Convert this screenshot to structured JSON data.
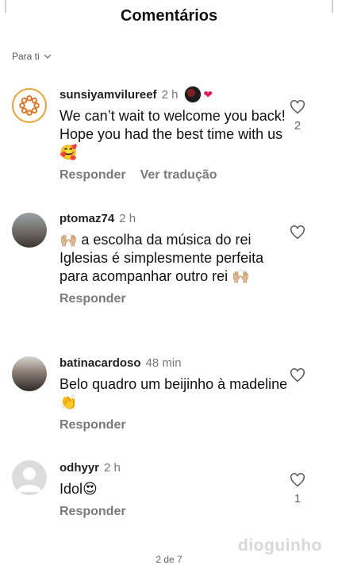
{
  "header": {
    "title": "Comentários"
  },
  "filter": {
    "label": "Para ti"
  },
  "comments": [
    {
      "user": "sunsiyamvilureef",
      "time": "2 h",
      "text": "We can’t wait to welcome you back! Hope you had the best time with us 🥰",
      "reply": "Responder",
      "translate": "Ver tradução",
      "likes": "2"
    },
    {
      "user": "ptomaz74",
      "time": "2 h",
      "text": "🙌🏼 a escolha da música do rei Iglesias é simplesmente perfeita para acompanhar outro rei 🙌🏼",
      "reply": "Responder",
      "likes": ""
    },
    {
      "user": "batinacardoso",
      "time": "48 min",
      "text": "Belo quadro um beijinho à madeline 👏",
      "reply": "Responder",
      "likes": ""
    },
    {
      "user": "odhyyr",
      "time": "2 h",
      "text": "Idol😍",
      "reply": "Responder",
      "likes": "1"
    }
  ],
  "footer": {
    "pager": "2 de 7"
  },
  "watermark": "dioguinho",
  "colors": {
    "accent_heart": "#e0245e",
    "muted": "#7a7a7a"
  }
}
